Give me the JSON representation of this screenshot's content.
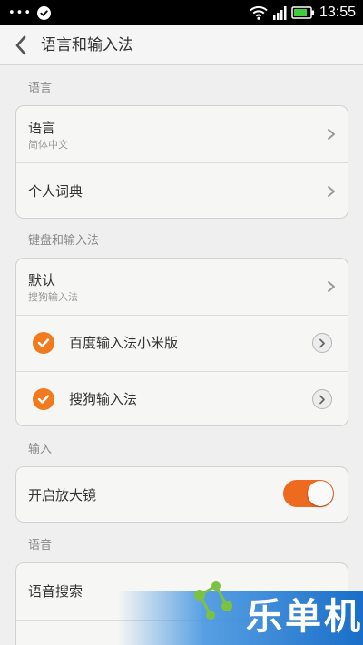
{
  "status_bar": {
    "time": "13:55",
    "notification_dots": "•••"
  },
  "header": {
    "title": "语言和输入法"
  },
  "sections": {
    "language": {
      "header": "语言",
      "items": [
        {
          "title": "语言",
          "subtitle": "简体中文"
        },
        {
          "title": "个人词典"
        }
      ]
    },
    "keyboard": {
      "header": "键盘和输入法",
      "default": {
        "title": "默认",
        "subtitle": "搜狗输入法"
      },
      "ime_items": [
        {
          "title": "百度输入法小米版",
          "checked": true
        },
        {
          "title": "搜狗输入法",
          "checked": true
        }
      ]
    },
    "input": {
      "header": "输入",
      "magnifier": {
        "title": "开启放大镜",
        "enabled": true
      }
    },
    "voice": {
      "header": "语音",
      "items": [
        {
          "title": "语音搜索"
        }
      ]
    }
  },
  "watermark": {
    "text": "乐单机"
  },
  "colors": {
    "accent": "#f07a1d",
    "toggle_on": "#ee6a1f",
    "watermark_blue": "#1a6ec8"
  }
}
